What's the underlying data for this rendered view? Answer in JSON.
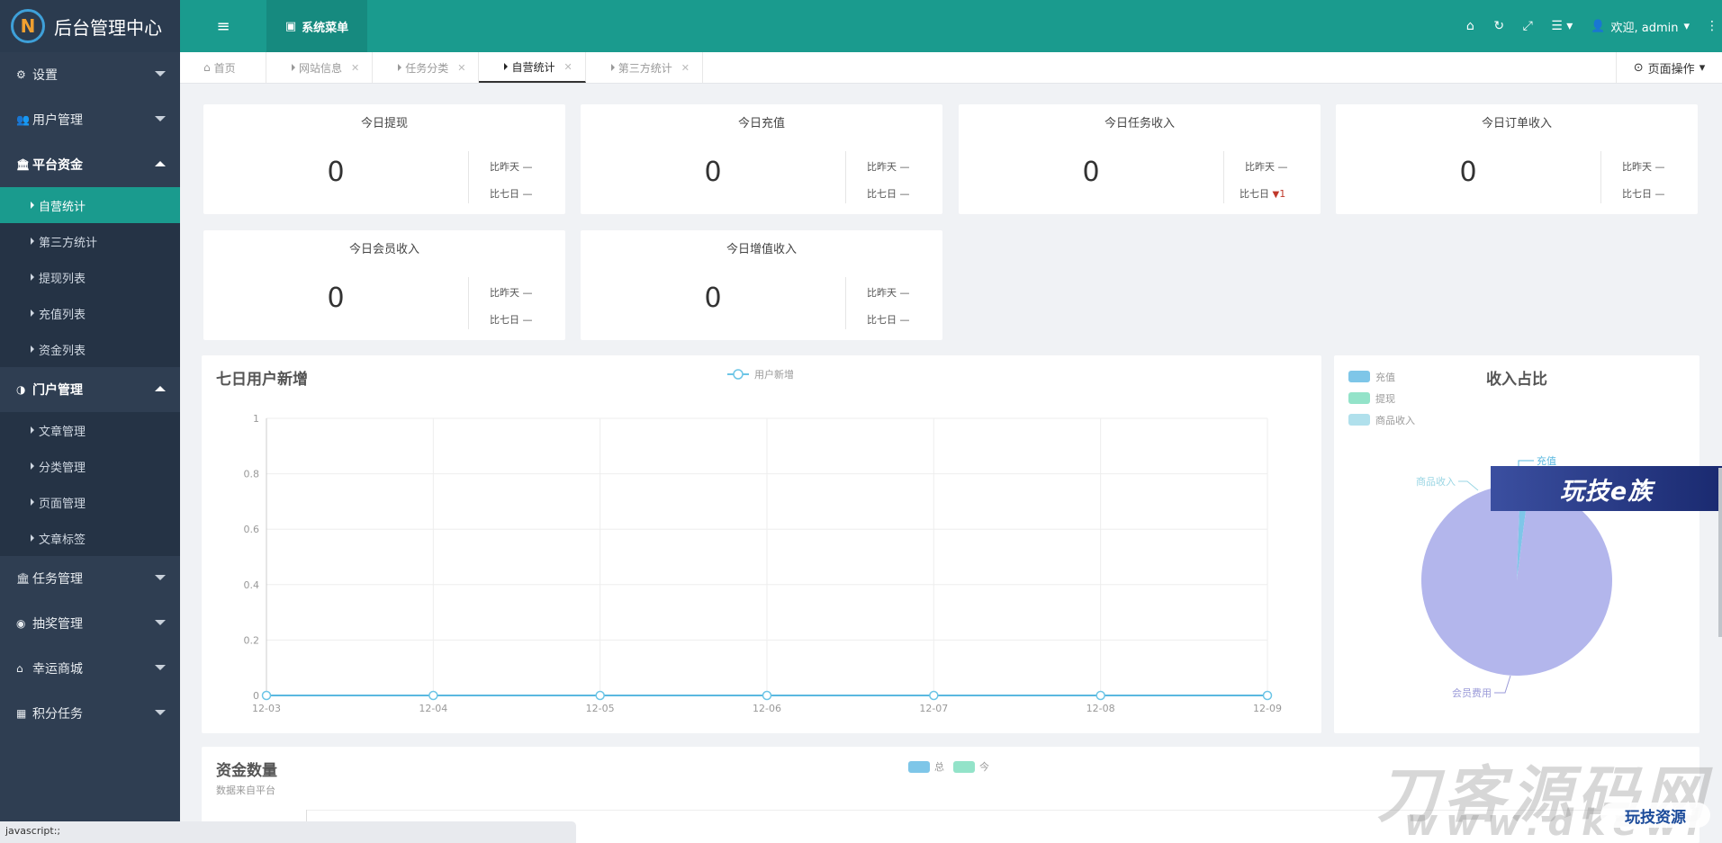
{
  "app": {
    "title": "后台管理中心",
    "logo_letter": "N"
  },
  "header": {
    "system_menu": "系统菜单",
    "welcome": "欢迎, admin",
    "icons": [
      "home-icon",
      "refresh-icon",
      "fullscreen-icon",
      "list-icon",
      "user-icon",
      "more-icon"
    ]
  },
  "sidebar": {
    "groups": [
      {
        "label": "设置",
        "icon": "gear-icon",
        "open": false
      },
      {
        "label": "用户管理",
        "icon": "users-icon",
        "open": false
      },
      {
        "label": "平台资金",
        "icon": "bank-icon",
        "open": true,
        "items": [
          "自营统计",
          "第三方统计",
          "提现列表",
          "充值列表",
          "资金列表"
        ],
        "active": 0
      },
      {
        "label": "门户管理",
        "icon": "globe-icon",
        "open": true,
        "items": [
          "文章管理",
          "分类管理",
          "页面管理",
          "文章标签"
        ]
      },
      {
        "label": "任务管理",
        "icon": "bank-icon",
        "open": false
      },
      {
        "label": "抽奖管理",
        "icon": "compass-icon",
        "open": false
      },
      {
        "label": "幸运商城",
        "icon": "shop-icon",
        "open": false
      },
      {
        "label": "积分任务",
        "icon": "grid-icon",
        "open": false
      }
    ]
  },
  "tabs": {
    "items": [
      "首页",
      "网站信息",
      "任务分类",
      "自营统计",
      "第三方统计"
    ],
    "active": 3,
    "page_ops": "页面操作"
  },
  "stats": [
    {
      "title": "今日提现",
      "value": "0",
      "c1": "比昨天 —",
      "c2": "比七日 —"
    },
    {
      "title": "今日充值",
      "value": "0",
      "c1": "比昨天 —",
      "c2": "比七日 —"
    },
    {
      "title": "今日任务收入",
      "value": "0",
      "c1": "比昨天 —",
      "c2": "比七日",
      "c2_arrow": "▼",
      "c2_val": "1"
    },
    {
      "title": "今日订单收入",
      "value": "0",
      "c1": "比昨天 —",
      "c2": "比七日 —"
    },
    {
      "title": "今日会员收入",
      "value": "0",
      "c1": "比昨天 —",
      "c2": "比七日 —"
    },
    {
      "title": "今日增值收入",
      "value": "0",
      "c1": "比昨天 —",
      "c2": "比七日 —"
    }
  ],
  "chart_data": [
    {
      "type": "line",
      "title": "七日用户新增",
      "x": [
        "12-03",
        "12-04",
        "12-05",
        "12-06",
        "12-07",
        "12-08",
        "12-09"
      ],
      "series": [
        {
          "name": "用户新增",
          "values": [
            0,
            0,
            0,
            0,
            0,
            0,
            0
          ]
        }
      ],
      "ylim": [
        0,
        1
      ],
      "yticks": [
        "0",
        "0.2",
        "0.4",
        "0.6",
        "0.8",
        "1"
      ],
      "legend": "top-center",
      "grid": true
    },
    {
      "type": "pie",
      "title": "收入占比",
      "legend": "top-left",
      "series": [
        {
          "name": "充值",
          "value": 1.5,
          "color": "#7ec6e8"
        },
        {
          "name": "提现",
          "value": 0,
          "color": "#93e3c9"
        },
        {
          "name": "商品收入",
          "value": 0,
          "color": "#b0e0ec"
        },
        {
          "name": "会员费用",
          "value": 98.5,
          "color": "#b3b6ec"
        }
      ],
      "legend_items": [
        "充值",
        "提现",
        "商品收入"
      ],
      "labels": [
        "充值",
        "商品收入",
        "会员费用"
      ]
    },
    {
      "type": "bar",
      "title": "资金数量",
      "subtitle": "数据来自平台",
      "series": [
        {
          "name": "总",
          "color": "#7ec6e8"
        },
        {
          "name": "今",
          "color": "#93e3c9"
        }
      ],
      "legend": "top-center"
    }
  ],
  "overlays": {
    "banner": "玩技e族",
    "watermark1": "刀客源码网",
    "watermark2": "www.dkewl",
    "watermark3": "玩技资源"
  },
  "status": {
    "text": "javascript:;"
  }
}
